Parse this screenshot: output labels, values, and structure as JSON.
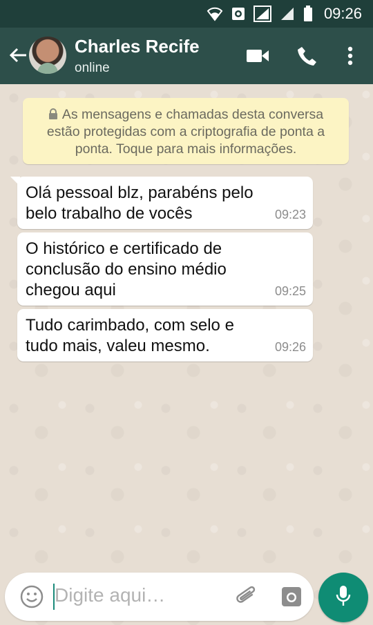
{
  "status_bar": {
    "time": "09:26",
    "icons": [
      "wifi-icon",
      "data-saver-icon",
      "signal-icon",
      "signal-icon-2",
      "battery-icon"
    ]
  },
  "header": {
    "contact_name": "Charles Recife",
    "contact_status": "online",
    "icons": [
      "back-arrow-icon",
      "avatar",
      "video-call-icon",
      "phone-icon",
      "more-options-icon"
    ]
  },
  "encryption_notice": "As mensagens e chamadas desta conversa estão protegidas com a criptografia de ponta a ponta. Toque para mais informações.",
  "messages": [
    {
      "text": "Olá pessoal blz,  parabéns pelo belo trabalho de vocês",
      "time": "09:23"
    },
    {
      "text": "O histórico e certificado de conclusão do ensino médio chegou aqui",
      "time": "09:25"
    },
    {
      "text": "Tudo carimbado, com selo e tudo mais, valeu mesmo.",
      "time": "09:26"
    }
  ],
  "input": {
    "placeholder": "Digite aqui…",
    "value": ""
  },
  "colors": {
    "app_bar": "#2d4f4a",
    "status_bar": "#1f3f3a",
    "encryption_bg": "#fcf4c4",
    "accent": "#0f8c74"
  }
}
